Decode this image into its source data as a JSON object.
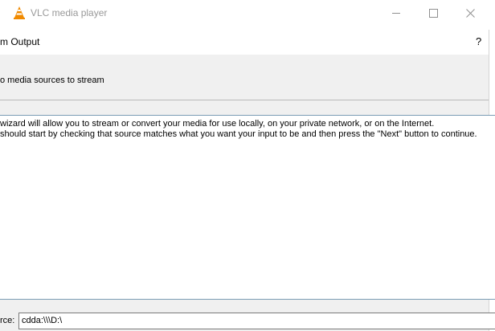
{
  "window": {
    "title": "VLC media player",
    "minimize_glyph": "—",
    "maximize_glyph": "☐",
    "close_glyph": "✕"
  },
  "dialog": {
    "title": "m Output",
    "help_glyph": "?",
    "step_title": "o media sources to stream",
    "intro_lines": [
      "wizard will allow you to stream or convert your media for use locally, on your private network, or on the Internet.",
      "should start by checking that source matches what you want your input to be and then press the \"Next\" button to continue."
    ],
    "source_label": "rce:",
    "source_value": "cdda:\\\\\\D:\\"
  },
  "colors": {
    "cone_orange": "#f08a00",
    "info_border": "#7b9db4"
  },
  "icons": {
    "app": "vlc-cone-icon",
    "minimize": "minimize-icon",
    "maximize": "maximize-icon",
    "close": "close-icon",
    "help": "help-icon"
  }
}
